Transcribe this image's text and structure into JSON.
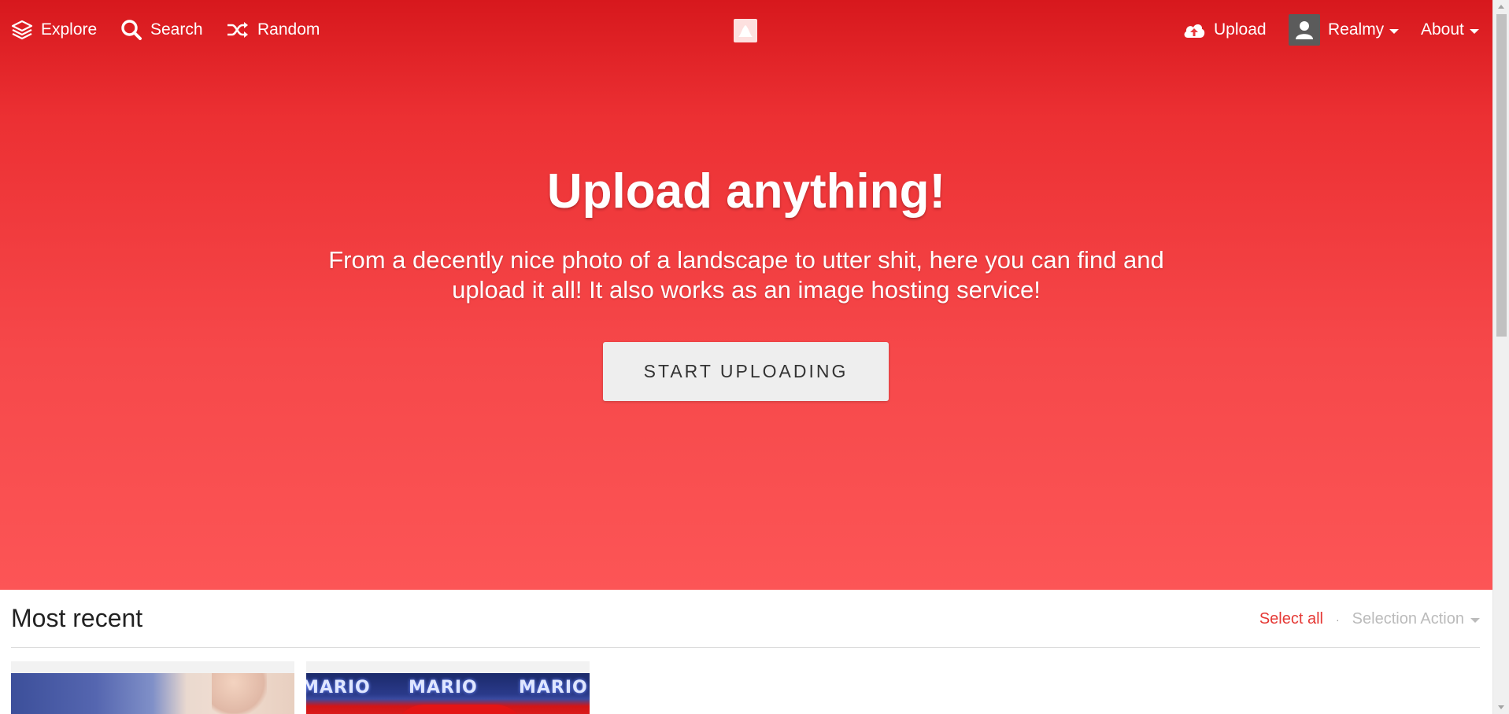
{
  "nav": {
    "left": [
      {
        "label": "Explore",
        "icon": "layers-icon"
      },
      {
        "label": "Search",
        "icon": "search-icon"
      },
      {
        "label": "Random",
        "icon": "shuffle-icon"
      }
    ],
    "right": {
      "upload_label": "Upload",
      "upload_icon": "cloud-upload-icon",
      "user_label": "Realmy",
      "user_icon": "user-avatar-icon",
      "about_label": "About"
    },
    "logo_icon": "peak-logo-icon"
  },
  "hero": {
    "title": "Upload anything!",
    "text": "From a decently nice photo of a landscape to utter shit, here you can find and upload it all! It also works as an image hosting service!",
    "button_label": "START UPLOADING"
  },
  "section": {
    "title": "Most recent",
    "select_all": "Select all",
    "separator": "·",
    "selection_action": "Selection Action"
  },
  "thumbs": {
    "mario_text": [
      "MARIO",
      "MARIO",
      "MARIO"
    ]
  },
  "colors": {
    "hero_top": "#d7181d",
    "hero_bottom": "#fc5556",
    "accent": "#e53935"
  }
}
